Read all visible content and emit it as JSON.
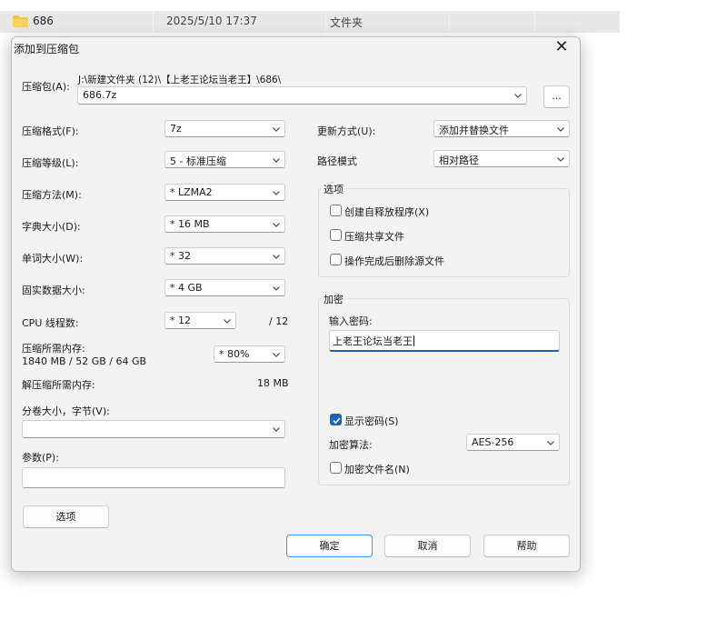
{
  "explorer": {
    "name": "686",
    "date": "2025/5/10 17:37",
    "type": "文件夹"
  },
  "dialog": {
    "title": "添加到压缩包",
    "close_glyph": "✕",
    "archive": {
      "label": "压缩包(A):",
      "path": "J:\\新建文件夹 (12)\\【上老王论坛当老王】\\686\\",
      "value": "686.7z",
      "browse_label": "..."
    },
    "left": {
      "format": {
        "label": "压缩格式(F):",
        "value": "7z"
      },
      "level": {
        "label": "压缩等级(L):",
        "value": "5 - 标准压缩"
      },
      "method": {
        "label": "压缩方法(M):",
        "value": "*  LZMA2"
      },
      "dict": {
        "label": "字典大小(D):",
        "value": "*  16 MB"
      },
      "word": {
        "label": "单词大小(W):",
        "value": "*  32"
      },
      "solid": {
        "label": "固实数据大小:",
        "value": "*  4 GB"
      },
      "cpu": {
        "label": "CPU 线程数:",
        "value": "*  12",
        "total": "/ 12"
      },
      "mem": {
        "label": "压缩所需内存:",
        "detail": "1840 MB / 52 GB / 64 GB",
        "value": "*  80%"
      },
      "decomp": {
        "label": "解压缩所需内存:",
        "value": "18 MB"
      },
      "split": {
        "label": "分卷大小，字节(V):",
        "value": ""
      },
      "params": {
        "label": "参数(P):",
        "value": ""
      }
    },
    "right": {
      "update": {
        "label": "更新方式(U):",
        "value": "添加并替换文件"
      },
      "path_mode": {
        "label": "路径模式",
        "value": "相对路径"
      },
      "options": {
        "title": "选项",
        "items": [
          {
            "label": "创建自释放程序(X)",
            "checked": false
          },
          {
            "label": "压缩共享文件",
            "checked": false
          },
          {
            "label": "操作完成后删除源文件",
            "checked": false
          }
        ]
      },
      "encryption": {
        "title": "加密",
        "password_label": "输入密码:",
        "password_value": "上老王论坛当老王",
        "show_password": {
          "label": "显示密码(S)",
          "checked": true
        },
        "method_label": "加密算法:",
        "method_value": "AES-256",
        "encrypt_names": {
          "label": "加密文件名(N)",
          "checked": false
        }
      }
    },
    "buttons": {
      "options": "选项",
      "ok": "确定",
      "cancel": "取消",
      "help": "帮助"
    }
  },
  "colors": {
    "accent": "#1f63b5",
    "dialog_bg": "#f3f3f3",
    "focus_border": "#4a90d6"
  }
}
